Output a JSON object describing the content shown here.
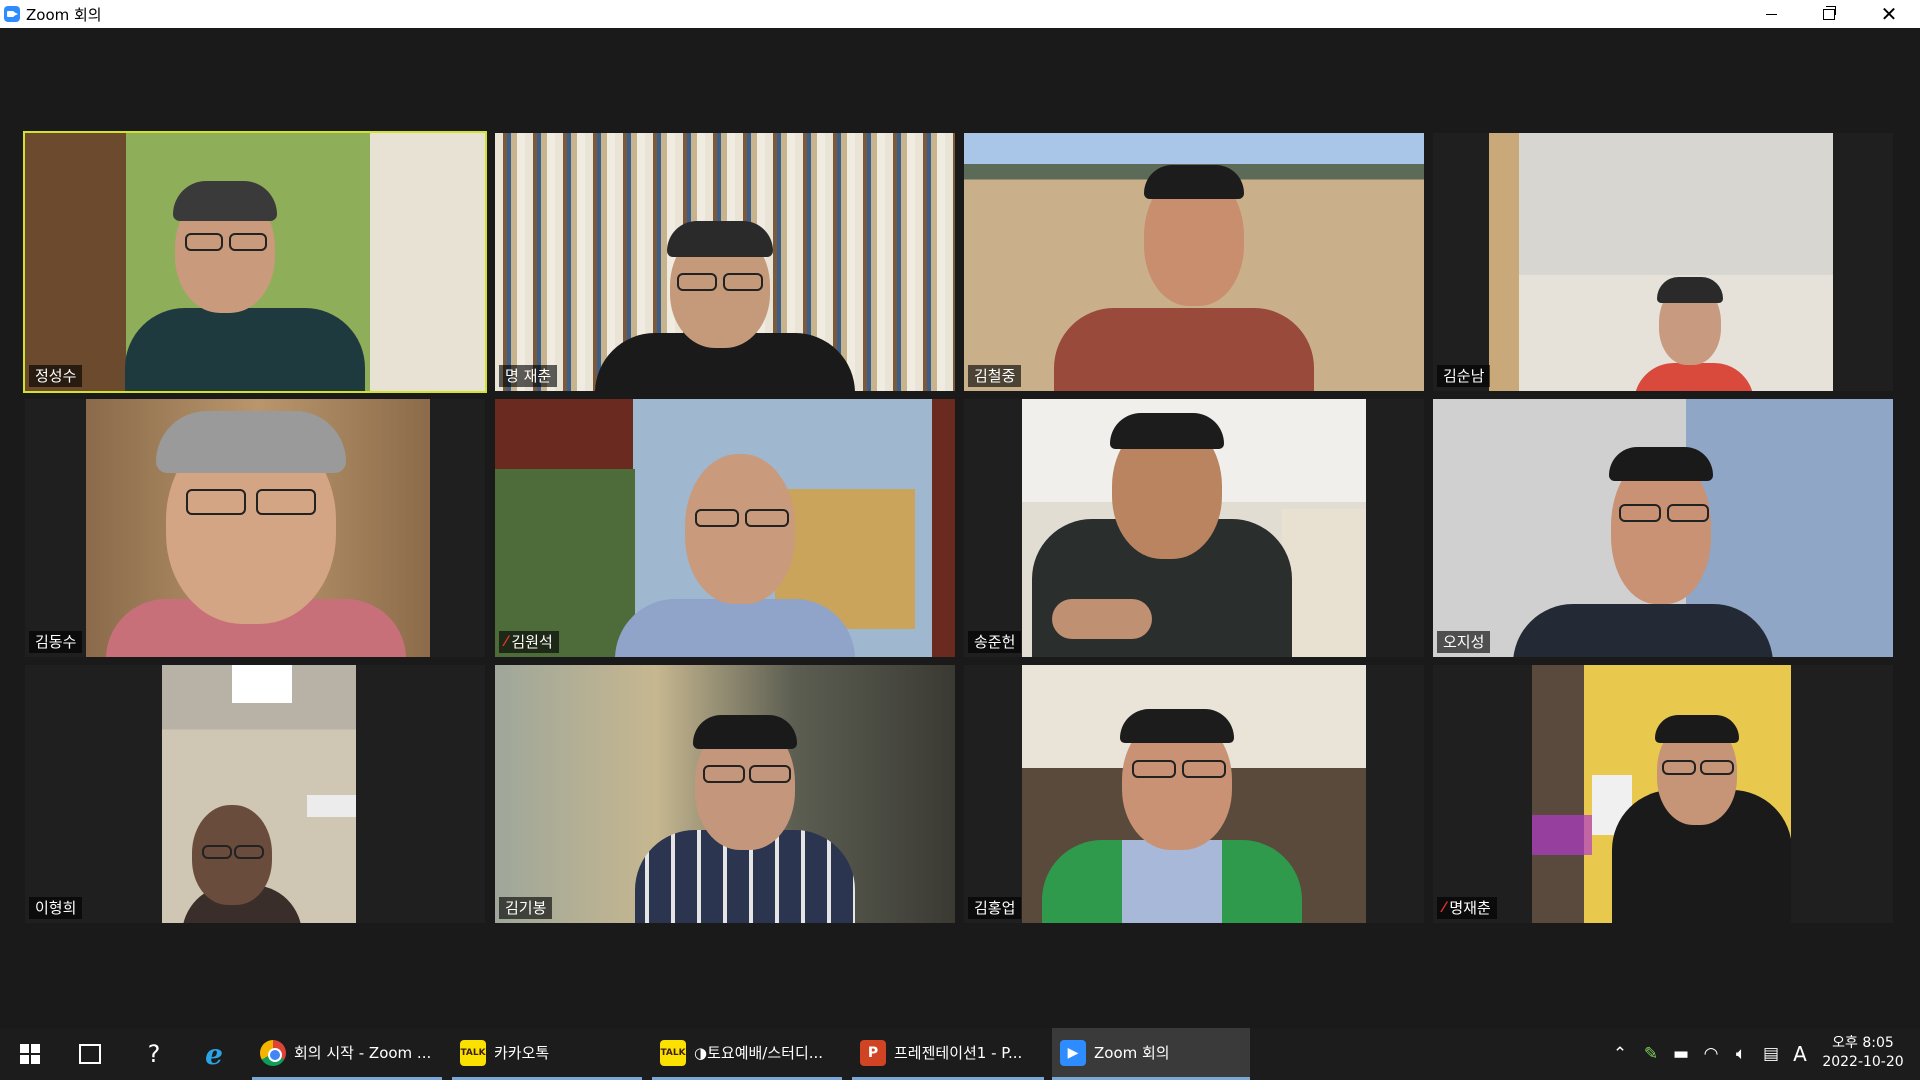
{
  "window": {
    "title": "Zoom 회의",
    "accent": "#2d8cff",
    "active_speaker_border": "#d2e22e"
  },
  "participants": [
    {
      "name": "정성수",
      "muted": false,
      "active": true
    },
    {
      "name": "명 재춘",
      "muted": false,
      "active": false
    },
    {
      "name": "김철중",
      "muted": false,
      "active": false
    },
    {
      "name": "김순남",
      "muted": false,
      "active": false
    },
    {
      "name": "김동수",
      "muted": false,
      "active": false
    },
    {
      "name": "김원석",
      "muted": true,
      "active": false
    },
    {
      "name": "송준헌",
      "muted": false,
      "active": false
    },
    {
      "name": "오지성",
      "muted": false,
      "active": false
    },
    {
      "name": "이형희",
      "muted": false,
      "active": false
    },
    {
      "name": "김기봉",
      "muted": false,
      "active": false
    },
    {
      "name": "김홍업",
      "muted": false,
      "active": false
    },
    {
      "name": "명재춘",
      "muted": true,
      "active": false
    }
  ],
  "taskbar": {
    "start_icon": "windows-logo-icon",
    "pinned": [
      "task-view-icon",
      "help-icon",
      "internet-explorer-icon"
    ],
    "tasks": [
      {
        "label": "회의 시작 - Zoom ...",
        "icon": "chrome-icon"
      },
      {
        "label": "카카오톡",
        "icon": "kakaotalk-icon",
        "icon_text": "TALK"
      },
      {
        "label": "◑토요예배/스터디...",
        "icon": "kakaotalk-icon",
        "icon_text": "TALK"
      },
      {
        "label": "프레젠테이션1 - P...",
        "icon": "powerpoint-icon",
        "icon_text": "P"
      },
      {
        "label": "Zoom 회의",
        "icon": "zoom-icon",
        "icon_text": "▶"
      }
    ],
    "tray": {
      "ime": "A",
      "time": "오후 8:05",
      "date": "2022-10-20"
    }
  }
}
